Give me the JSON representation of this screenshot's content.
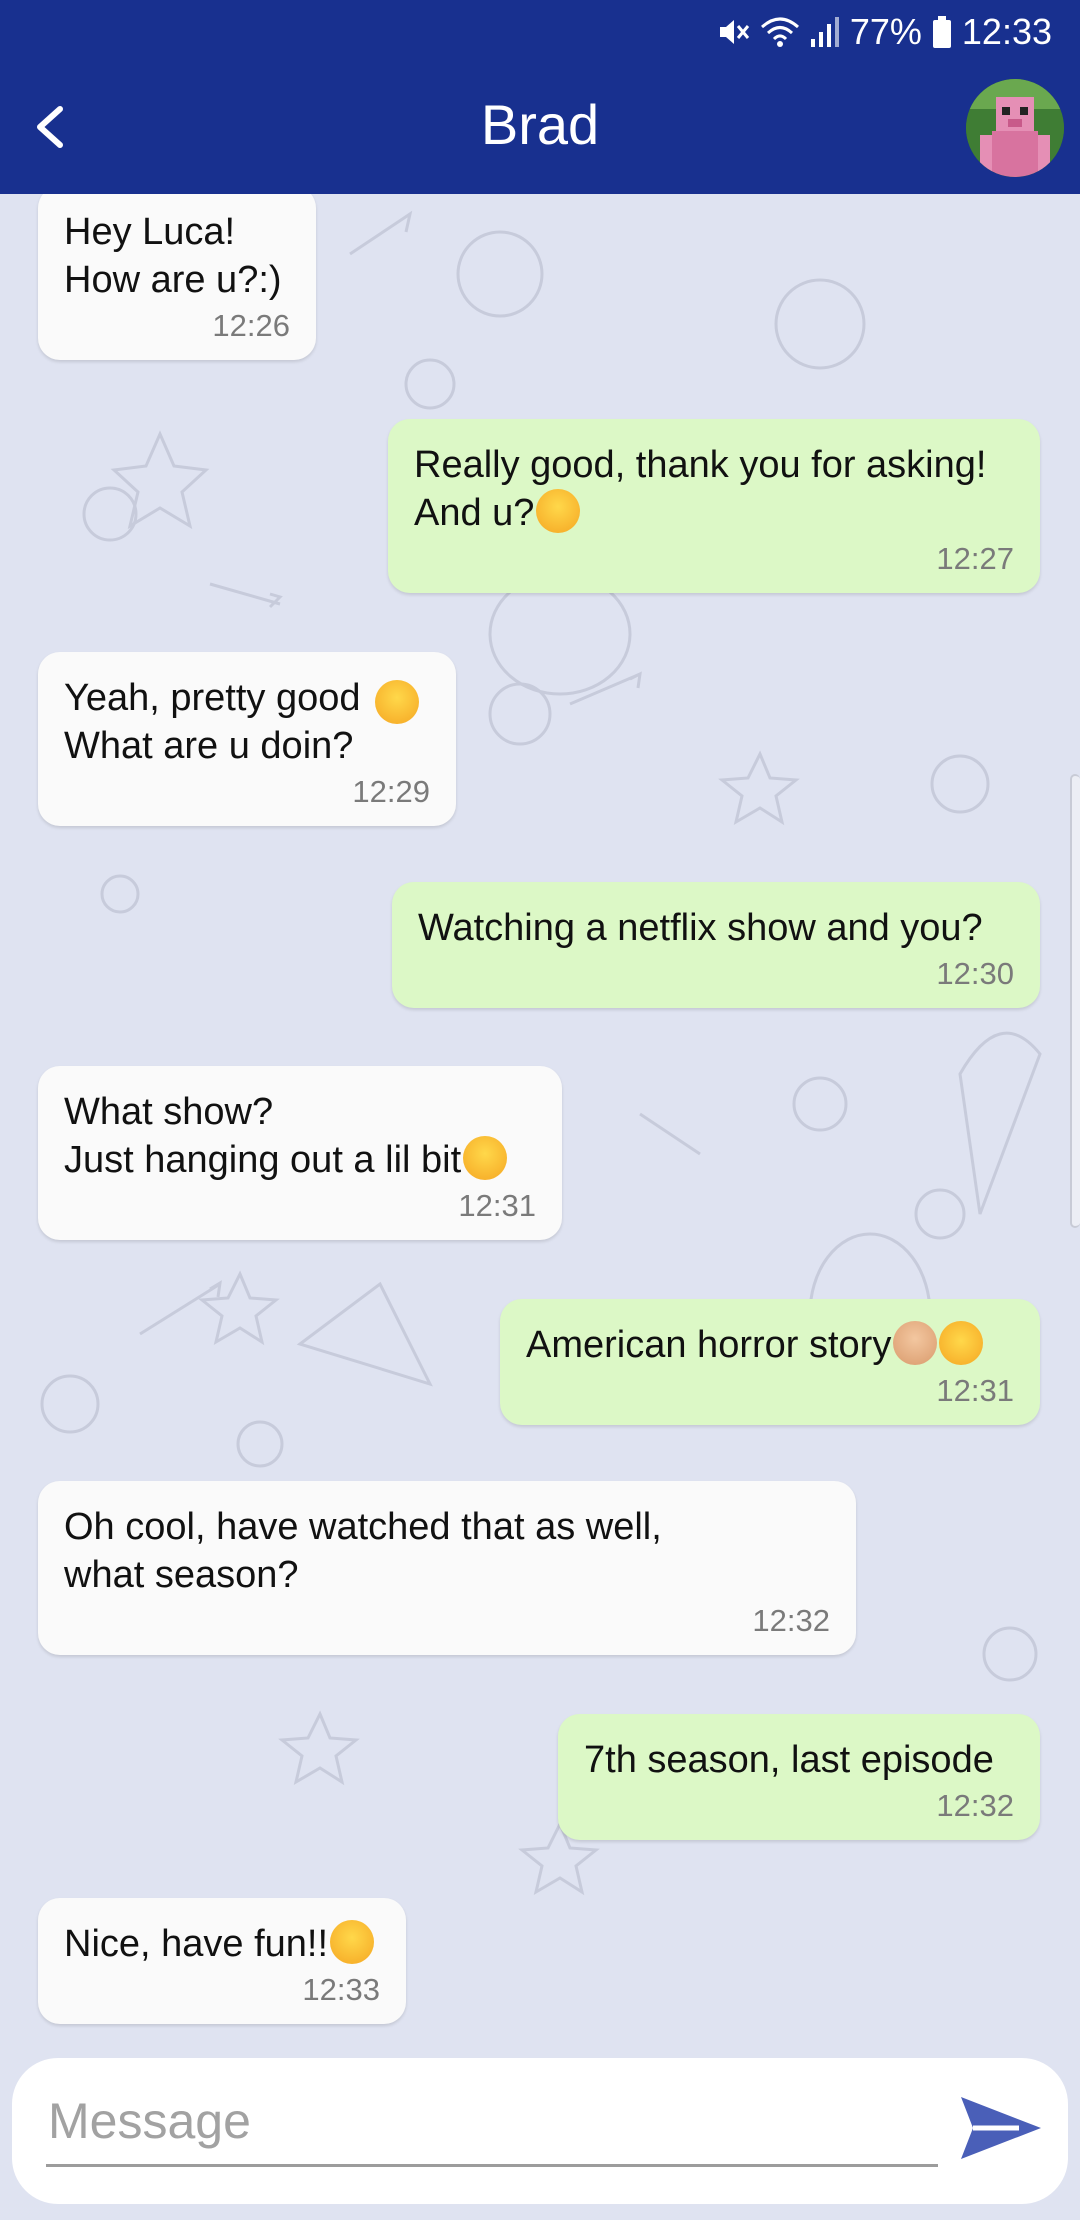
{
  "status_bar": {
    "battery": "77%",
    "time": "12:33",
    "icons": [
      "mute-icon",
      "wifi-icon",
      "signal-icon",
      "battery-icon"
    ]
  },
  "header": {
    "title": "Brad",
    "back_icon": "chevron-left-icon",
    "avatar": "contact-avatar"
  },
  "messages": [
    {
      "from": "them",
      "text": "Hey Luca!\nHow are u?:)",
      "time": "12:26"
    },
    {
      "from": "me",
      "text": "Really good, thank you for asking!\nAnd u?",
      "emoji": [
        "smiling-face-emoji"
      ],
      "time": "12:27"
    },
    {
      "from": "them",
      "text": "Yeah, pretty good\nWhat are u doin?",
      "emoji": [
        "grinning-face-emoji"
      ],
      "time": "12:29"
    },
    {
      "from": "me",
      "text": "Watching a netflix show and you?",
      "time": "12:30"
    },
    {
      "from": "them",
      "text": "What show?\nJust hanging out a lil bit",
      "emoji": [
        "yum-face-emoji"
      ],
      "time": "12:31"
    },
    {
      "from": "me",
      "text": "American horror story",
      "emoji": [
        "crossed-fingers-emoji",
        "mind-blown-emoji"
      ],
      "time": "12:31"
    },
    {
      "from": "them",
      "text": "Oh cool, have watched that as well,\nwhat season?",
      "time": "12:32"
    },
    {
      "from": "me",
      "text": "7th season, last episode",
      "time": "12:32"
    },
    {
      "from": "them",
      "text": "Nice, have fun!!",
      "emoji": [
        "yum-face-emoji"
      ],
      "time": "12:33"
    }
  ],
  "composer": {
    "placeholder": "Message",
    "value": "",
    "send_icon": "send-icon"
  },
  "colors": {
    "header": "#18308f",
    "background": "#dfe3f1",
    "incoming_bubble": "#fafafa",
    "outgoing_bubble": "#dcf8c6",
    "send": "#4a5fb8"
  }
}
